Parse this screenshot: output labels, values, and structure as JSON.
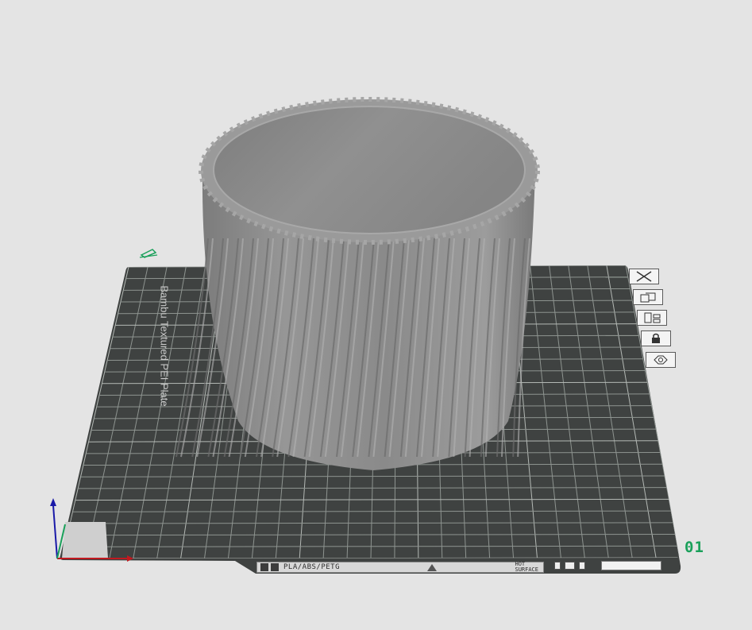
{
  "plate": {
    "brand_label": "Bambu Textured PEI Plate",
    "plate_number": "01",
    "plate_number_color": "#1aa05a",
    "materials_label": "PLA/ABS/PETG",
    "hot_surface_label_line1": "HOT",
    "hot_surface_label_line2": "SURFACE"
  },
  "plate_tools": [
    {
      "name": "delete-plate-icon",
      "tooltip": "Remove plate"
    },
    {
      "name": "arrange-plate-icon",
      "tooltip": "Arrange"
    },
    {
      "name": "orient-plate-icon",
      "tooltip": "Auto orient"
    },
    {
      "name": "lock-plate-icon",
      "tooltip": "Lock"
    },
    {
      "name": "plate-settings-icon",
      "tooltip": "Plate settings"
    }
  ],
  "colors": {
    "background": "#e4e4e4",
    "plate": "#3f4241",
    "grid": "#9aa09c",
    "model": "#8c8c8c",
    "axis_x": "#c0191f",
    "axis_y": "#1aa05a",
    "axis_z": "#1a1aa8",
    "edit_icon": "#1aa05a"
  }
}
